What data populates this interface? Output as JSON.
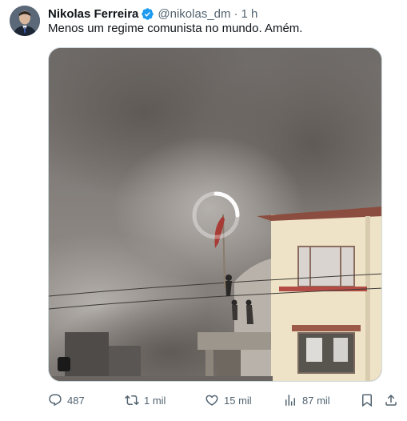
{
  "tweet": {
    "author_name": "Nikolas Ferreira",
    "handle": "@nikolas_dm",
    "separator": "·",
    "time": "1 h",
    "text": "Menos um regime comunista no mundo. Amém.",
    "verified": true
  },
  "actions": {
    "replies": "487",
    "retweets": "1 mil",
    "likes": "15 mil",
    "views": "87 mil"
  },
  "icons": {
    "verified": "verified-badge-icon",
    "reply": "reply-icon",
    "retweet": "retweet-icon",
    "like": "heart-icon",
    "views": "views-chart-icon",
    "bookmark": "bookmark-icon",
    "share": "share-icon",
    "loading": "loading-spinner-icon"
  },
  "colors": {
    "accent": "#1d9bf0",
    "secondary_text": "#536471",
    "primary_text": "#0f1419"
  }
}
